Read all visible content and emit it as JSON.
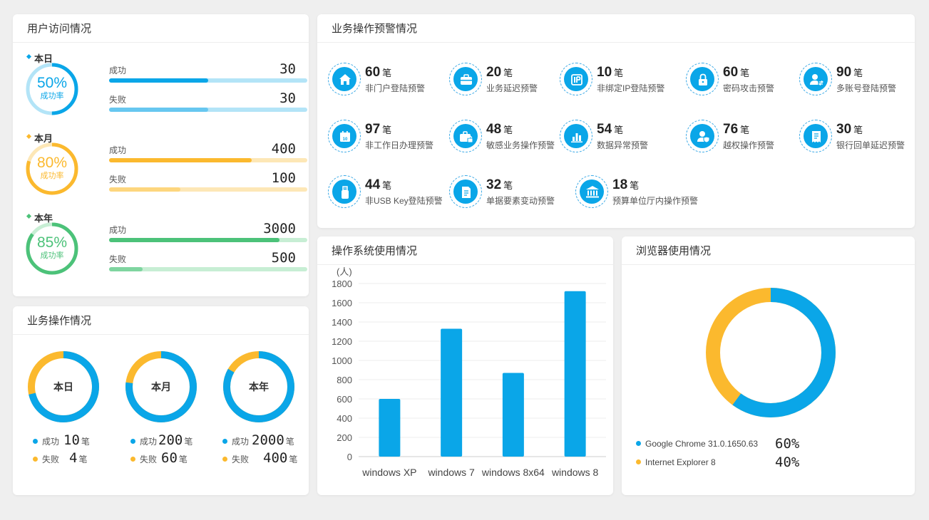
{
  "colors": {
    "blue": "#0aa6e8",
    "blue_light": "#b3e4f7",
    "blue_mid": "#67c7f0",
    "yellow": "#fbb92e",
    "yellow_light": "#fde7b6",
    "yellow_mid": "#fdd67e",
    "green": "#4cc279",
    "green_light": "#c7eed4",
    "green_mid": "#7fd5a0"
  },
  "user_access": {
    "title": "用户访问情况",
    "periods": [
      {
        "label": "本日",
        "pct": "50%",
        "rate_label": "成功率",
        "rate": 0.5,
        "success_label": "成功",
        "success": "30",
        "success_ratio": 0.5,
        "fail_label": "失败",
        "fail": "30",
        "fail_ratio": 0.5
      },
      {
        "label": "本月",
        "pct": "80%",
        "rate_label": "成功率",
        "rate": 0.8,
        "success_label": "成功",
        "success": "400",
        "success_ratio": 0.72,
        "fail_label": "失败",
        "fail": "100",
        "fail_ratio": 0.36
      },
      {
        "label": "本年",
        "pct": "85%",
        "rate_label": "成功率",
        "rate": 0.85,
        "success_label": "成功",
        "success": "3000",
        "success_ratio": 0.86,
        "fail_label": "失败",
        "fail": "500",
        "fail_ratio": 0.17
      }
    ]
  },
  "business_ops": {
    "title": "业务操作情况",
    "unit": "笔",
    "items": [
      {
        "label": "本日",
        "success_label": "成功",
        "success": "10",
        "fail_label": "失败",
        "fail": "4",
        "success_ratio": 0.714
      },
      {
        "label": "本月",
        "success_label": "成功",
        "success": "200",
        "fail_label": "失败",
        "fail": "60",
        "success_ratio": 0.769
      },
      {
        "label": "本年",
        "success_label": "成功",
        "success": "2000",
        "fail_label": "失败",
        "fail": "400",
        "success_ratio": 0.833
      }
    ]
  },
  "warnings": {
    "title": "业务操作预警情况",
    "unit": "笔",
    "items": [
      {
        "value": "60",
        "label": "非门户登陆预警",
        "icon": "home-icon"
      },
      {
        "value": "20",
        "label": "业务延迟预警",
        "icon": "briefcase-icon"
      },
      {
        "value": "10",
        "label": "非绑定IP登陆预警",
        "icon": "ip-icon"
      },
      {
        "value": "60",
        "label": "密码攻击预警",
        "icon": "lock-icon"
      },
      {
        "value": "90",
        "label": "多账号登陆预警",
        "icon": "user-switch-icon"
      },
      {
        "value": "97",
        "label": "非工作日办理预警",
        "icon": "calendar-icon"
      },
      {
        "value": "48",
        "label": "敏感业务操作预警",
        "icon": "briefcase-lock-icon"
      },
      {
        "value": "54",
        "label": "数据异常预警",
        "icon": "bar-chart-icon"
      },
      {
        "value": "76",
        "label": "越权操作预警",
        "icon": "user-shield-icon"
      },
      {
        "value": "30",
        "label": "银行回单延迟预警",
        "icon": "receipt-icon"
      },
      {
        "value": "44",
        "label": "非USB Key登陆预警",
        "icon": "usb-key-icon"
      },
      {
        "value": "32",
        "label": "单据要素变动预警",
        "icon": "document-icon"
      },
      {
        "value": "18",
        "label": "预算单位厅内操作预警",
        "icon": "bank-icon"
      }
    ]
  },
  "os_usage": {
    "title": "操作系统使用情况"
  },
  "browser_usage": {
    "title": "浏览器使用情况",
    "items": [
      {
        "name": "Google Chrome 31.0.1650.63",
        "pct": "60%",
        "value": 60
      },
      {
        "name": "Internet Explorer 8",
        "pct": "40%",
        "value": 40
      }
    ]
  },
  "chart_data": {
    "type": "bar",
    "unit_label": "(人)",
    "categories": [
      "windows XP",
      "windows 7",
      "windows 8x64",
      "windows 8"
    ],
    "values": [
      600,
      1330,
      870,
      1720
    ],
    "ylim": [
      0,
      1800
    ],
    "yticks": [
      "0",
      "200",
      "400",
      "600",
      "800",
      "1000",
      "1200",
      "1400",
      "1600",
      "1800"
    ],
    "grid": true
  }
}
